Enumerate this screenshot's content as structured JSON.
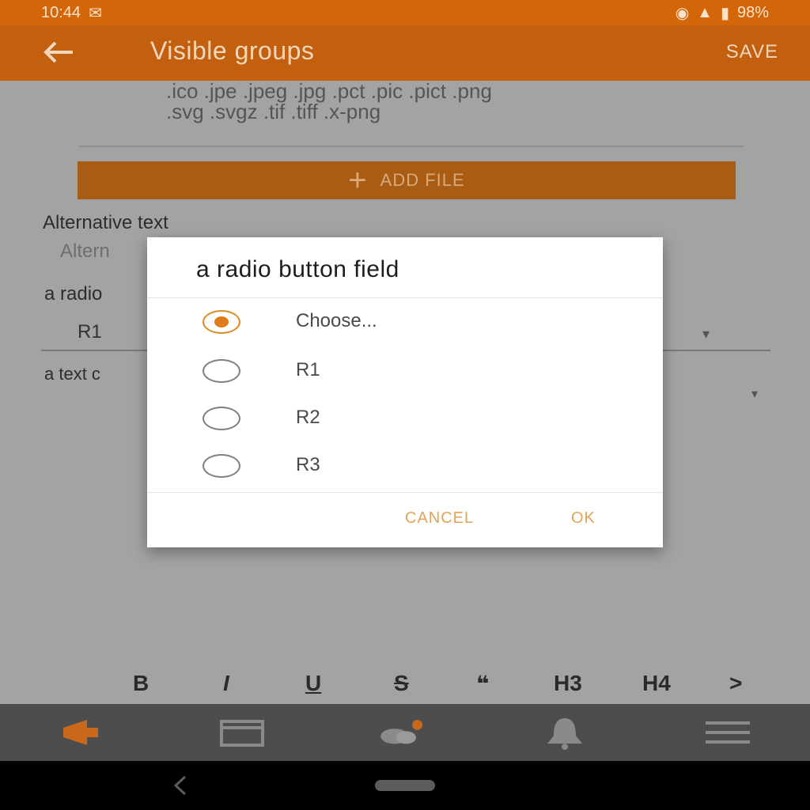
{
  "status_bar": {
    "time": "10:44",
    "right_text": "98%"
  },
  "app_bar": {
    "title": "Visible groups",
    "save_label": "SAVE"
  },
  "form": {
    "file_types_line1": ".ico .jpe .jpeg .jpg .pct .pic .pict .png",
    "file_types_line2": ".svg .svgz .tif .tiff .x-png",
    "add_file_label": "ADD FILE",
    "alternative_text_label": "Alternative text",
    "alternative_text_placeholder": "Altern",
    "radio_field_label": "a radio",
    "radio_field_value": "R1",
    "text_field_label": "a text c"
  },
  "dialog": {
    "title": "a radio button field",
    "options": [
      {
        "label": "Choose...",
        "selected": true
      },
      {
        "label": "R1",
        "selected": false
      },
      {
        "label": "R2",
        "selected": false
      },
      {
        "label": "R3",
        "selected": false
      }
    ],
    "cancel_label": "CANCEL",
    "ok_label": "OK"
  },
  "format_toolbar": {
    "bold": "B",
    "italic": "I",
    "underline": "U",
    "strike": "S",
    "quote": "❝",
    "h3": "H3",
    "h4": "H4",
    "more": ">"
  },
  "bottom_nav": {
    "items": [
      "megaphone-icon",
      "calendar-icon",
      "chat-icon",
      "bell-icon",
      "menu-icon"
    ]
  },
  "colors": {
    "accent": "#e07c1c",
    "app_bar": "#c2600f",
    "status_bar": "#d4660a"
  }
}
